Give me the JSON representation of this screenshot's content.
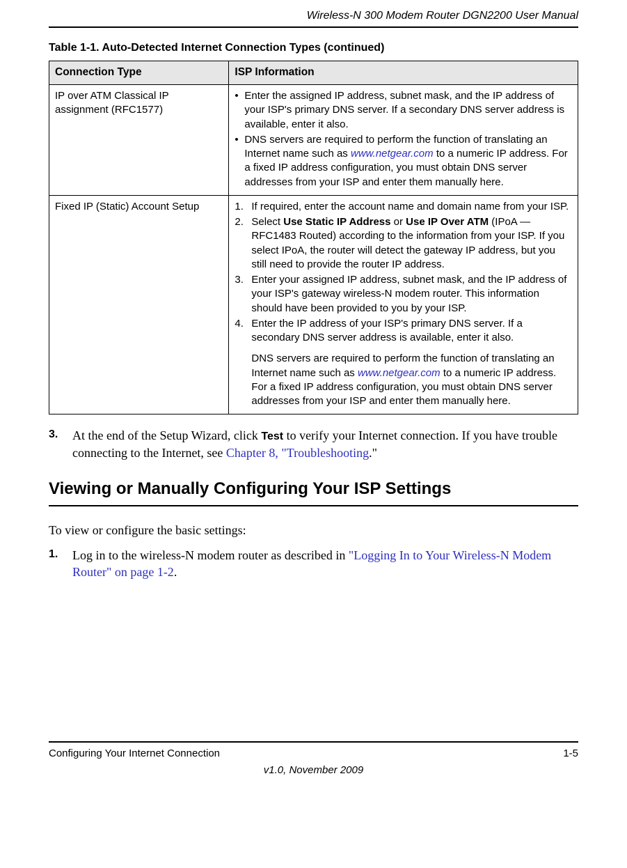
{
  "header": {
    "title": "Wireless-N 300 Modem Router DGN2200 User Manual"
  },
  "table": {
    "caption_prefix": "Table 1-1. Auto-Detected Internet Connection Types",
    "caption_suffix": "  (continued)",
    "headers": {
      "col1": "Connection Type",
      "col2": "ISP Information"
    },
    "rows": [
      {
        "type": "IP over ATM Classical IP assignment (RFC1577)",
        "bullets": [
          {
            "pre": "Enter the assigned IP address, subnet mask, and the IP address of your ISP's primary DNS server. If a secondary DNS server address is available, enter it also.",
            "link": "",
            "post": ""
          },
          {
            "pre": "DNS servers are required to perform the function of translating an Internet name such as ",
            "link": "www.netgear.com",
            "post": " to a numeric IP address. For a fixed IP address configuration, you must obtain DNS server addresses from your ISP and enter them manually here."
          }
        ]
      },
      {
        "type": "Fixed IP (Static) Account Setup",
        "steps": [
          {
            "num": "1.",
            "segs": [
              {
                "t": "If required, enter the account name and domain name from your ISP."
              }
            ]
          },
          {
            "num": "2.",
            "segs": [
              {
                "t": "Select "
              },
              {
                "t": "Use Static IP Address",
                "bold": true
              },
              {
                "t": " or "
              },
              {
                "t": "Use IP Over ATM",
                "bold": true
              },
              {
                "t": " (IPoA — RFC1483 Routed) according to the information from your ISP. If you select IPoA, the router will detect the gateway IP address, but you still need to provide the router IP address."
              }
            ]
          },
          {
            "num": "3.",
            "segs": [
              {
                "t": "Enter your assigned IP address, subnet mask, and the IP address of your ISP's gateway wireless-N modem router. This information should have been provided to you by your ISP."
              }
            ]
          },
          {
            "num": "4.",
            "segs": [
              {
                "t": "Enter the IP address of your ISP's primary DNS server. If a secondary DNS server address is available, enter it also."
              }
            ]
          }
        ],
        "tail": {
          "pre": "DNS servers are required to perform the function of translating an Internet name such as ",
          "link": "www.netgear.com",
          "post": " to a numeric IP address. For a fixed IP address configuration, you must obtain DNS server addresses from your ISP and enter them manually here."
        }
      }
    ]
  },
  "step3": {
    "num": "3.",
    "pre": "At the end of the Setup Wizard, click ",
    "bold": "Test",
    "mid": " to verify your Internet connection. If you have trouble connecting to the Internet, see ",
    "link": "Chapter 8, \"Troubleshooting",
    "post": ".\""
  },
  "section_heading": "Viewing or Manually Configuring Your ISP Settings",
  "intro_para": "To view or configure the basic settings:",
  "step1": {
    "num": "1.",
    "pre": "Log in to the wireless-N modem router as described in ",
    "link": "\"Logging In to Your Wireless-N Modem Router\" on page 1-2",
    "post": "."
  },
  "footer": {
    "chapter": "Configuring Your Internet Connection",
    "page": "1-5",
    "version": "v1.0, November 2009"
  }
}
